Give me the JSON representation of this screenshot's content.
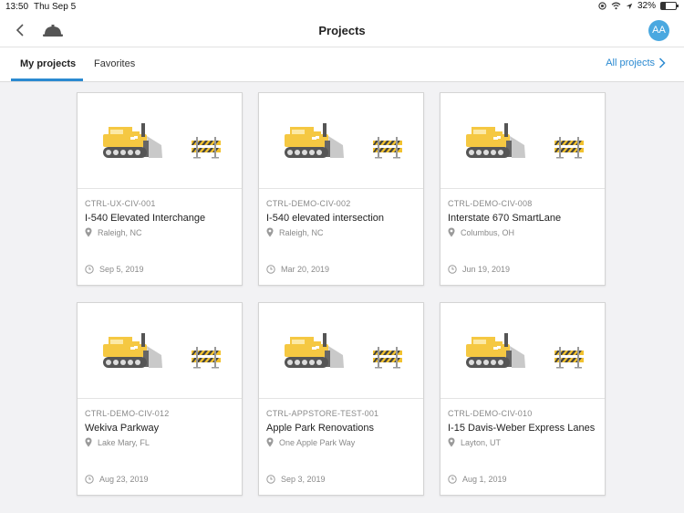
{
  "status": {
    "time": "13:50",
    "date": "Thu Sep 5",
    "battery": "32%",
    "battery_level": 0.32
  },
  "navbar": {
    "title": "Projects",
    "avatar_initials": "AA"
  },
  "tabs": {
    "my_projects": "My projects",
    "favorites": "Favorites",
    "all_projects": "All projects"
  },
  "projects": [
    {
      "code": "CTRL-UX-CIV-001",
      "name": "I-540 Elevated Interchange",
      "location": "Raleigh, NC",
      "date": "Sep 5, 2019"
    },
    {
      "code": "CTRL-DEMO-CIV-002",
      "name": "I-540 elevated intersection",
      "location": "Raleigh, NC",
      "date": "Mar 20, 2019"
    },
    {
      "code": "CTRL-DEMO-CIV-008",
      "name": "Interstate 670 SmartLane",
      "location": "Columbus, OH",
      "date": "Jun 19, 2019"
    },
    {
      "code": "CTRL-DEMO-CIV-012",
      "name": "Wekiva Parkway",
      "location": "Lake Mary, FL",
      "date": "Aug 23, 2019"
    },
    {
      "code": "CTRL-APPSTORE-TEST-001",
      "name": "Apple Park Renovations",
      "location": "One Apple Park Way",
      "date": "Sep 3, 2019"
    },
    {
      "code": "CTRL-DEMO-CIV-010",
      "name": "I-15 Davis-Weber Express Lanes",
      "location": "Layton, UT",
      "date": "Aug 1, 2019"
    }
  ],
  "colors": {
    "accent": "#2b8ad1",
    "avatar": "#4aa8e0",
    "machine_yellow": "#f5c842",
    "barrier_yellow": "#f2c230"
  },
  "icons": {
    "back": "chevron-left-icon",
    "logo": "hardhat-icon",
    "location": "pin-icon",
    "date": "clock-icon",
    "wifi": "wifi-icon",
    "location_services": "arrow-icon"
  }
}
